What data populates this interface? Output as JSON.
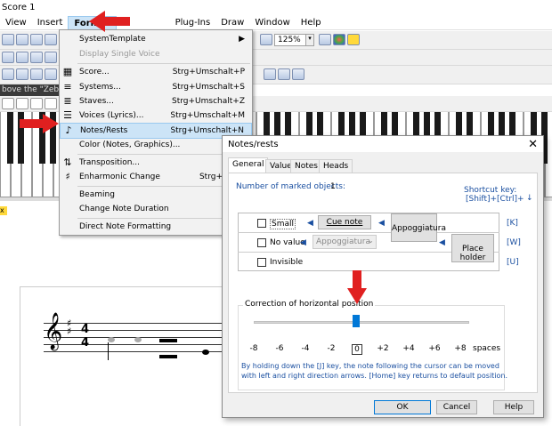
{
  "app": {
    "title": "Score 1"
  },
  "menubar": {
    "items": [
      "View",
      "Insert",
      "Format",
      "",
      "Plug-Ins",
      "Draw",
      "Window",
      "Help"
    ]
  },
  "toolbar": {
    "zoom": "125%",
    "zoom_dd": "▾"
  },
  "infobar": {
    "text": "bove the \"Zebra"
  },
  "format_menu": {
    "items": [
      {
        "label": "SystemTemplate",
        "shortcut": "",
        "arrow": "▶"
      },
      {
        "label": "Display Single Voice",
        "shortcut": ""
      },
      {
        "label": "Score...",
        "shortcut": "Strg+Umschalt+P"
      },
      {
        "label": "Systems...",
        "shortcut": "Strg+Umschalt+S"
      },
      {
        "label": "Staves...",
        "shortcut": "Strg+Umschalt+Z"
      },
      {
        "label": "Voices (Lyrics)...",
        "shortcut": "Strg+Umschalt+M"
      },
      {
        "label": "Notes/Rests",
        "shortcut": "Strg+Umschalt+N"
      },
      {
        "label": "Color (Notes, Graphics)...",
        "shortcut": ""
      },
      {
        "label": "Transposition...",
        "shortcut": ""
      },
      {
        "label": "Enharmonic Change",
        "shortcut": "Strg+Umsc"
      },
      {
        "label": "Beaming",
        "shortcut": ""
      },
      {
        "label": "Change Note Duration",
        "shortcut": ""
      },
      {
        "label": "Direct Note Formatting",
        "shortcut": ""
      }
    ]
  },
  "dialog": {
    "title": "Notes/rests",
    "close": "✕",
    "tabs": [
      "General",
      "Value",
      "Notes",
      "Heads"
    ],
    "marked_label": "Number of marked objects:",
    "marked_count": "1",
    "shortcut_label": "Shortcut key:",
    "shortcut_keys": "[Shift]+[Ctrl]+",
    "options": {
      "small": "Small",
      "no_value": "No value",
      "invisible": "Invisible",
      "cue_note": "Cue note",
      "appoggiatura_select": "Appoggiatura",
      "appoggiatura_btn": "Appoggiatura",
      "place_holder": "Place holder",
      "key_k": "[K]",
      "key_w": "[W]",
      "key_u": "[U]"
    },
    "correction": {
      "label": "Correction of horizontal position",
      "ticks": [
        "-8",
        "-6",
        "-4",
        "-2",
        "0",
        "+2",
        "+4",
        "+6",
        "+8"
      ],
      "unit": "spaces",
      "value": 0,
      "hint_line1": "By holding down the [J] key, the note following the cursor can be moved",
      "hint_line2": "with left and right direction arrows. [Home] key returns to default position."
    },
    "buttons": {
      "ok": "OK",
      "cancel": "Cancel",
      "help": "Help"
    }
  },
  "colors": {
    "accent": "#0078d7",
    "highlight": "#cce4f7",
    "arrow": "#e02020",
    "link": "#1a4fa0"
  }
}
